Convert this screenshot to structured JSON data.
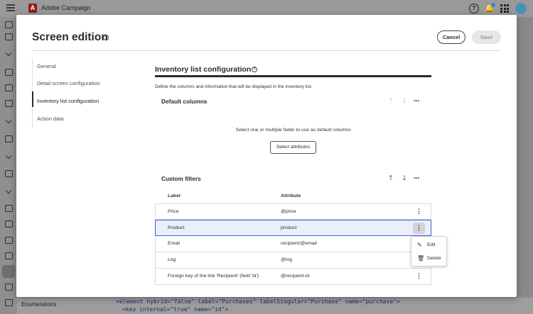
{
  "app": {
    "brand_name": "Adobe Campaign",
    "bottom_label": "Enumerations",
    "code_line_1": "<element hybrid=\"false\" label=\"Purchases\" labelSingular=\"Purchase\" name=\"purchase\">",
    "code_line_2": "<key internal=\"true\" name=\"id\">"
  },
  "modal": {
    "title": "Screen edition",
    "cancel_label": "Cancel",
    "save_label": "Save"
  },
  "nav": {
    "items": [
      {
        "label": "General"
      },
      {
        "label": "Detail screen configuration"
      },
      {
        "label": "Inventory list configuration",
        "active": true
      },
      {
        "label": "Action data"
      }
    ]
  },
  "inventory": {
    "title": "Inventory list configuration",
    "description": "Define the columns and information that will be displayed in the inventory list.",
    "default_columns": {
      "title": "Default columns",
      "empty_text": "Select one or multiple fields to use as default columns",
      "select_button": "Select attributes"
    },
    "custom_filters": {
      "title": "Custom filters",
      "col_label": "Label",
      "col_attribute": "Attribute",
      "rows": [
        {
          "label": "Price",
          "attribute": "@price"
        },
        {
          "label": "Product",
          "attribute": "product"
        },
        {
          "label": "Email",
          "attribute": "recipient/@email"
        },
        {
          "label": "Log",
          "attribute": "@log"
        },
        {
          "label": "Foreign key of the link 'Recipient' (field 'id')",
          "attribute": "@recipient-id"
        }
      ]
    }
  },
  "context_menu": {
    "edit_label": "Edit",
    "delete_label": "Delete"
  },
  "colors": {
    "accent": "#3b63c8",
    "brand": "#8e1e1a"
  }
}
